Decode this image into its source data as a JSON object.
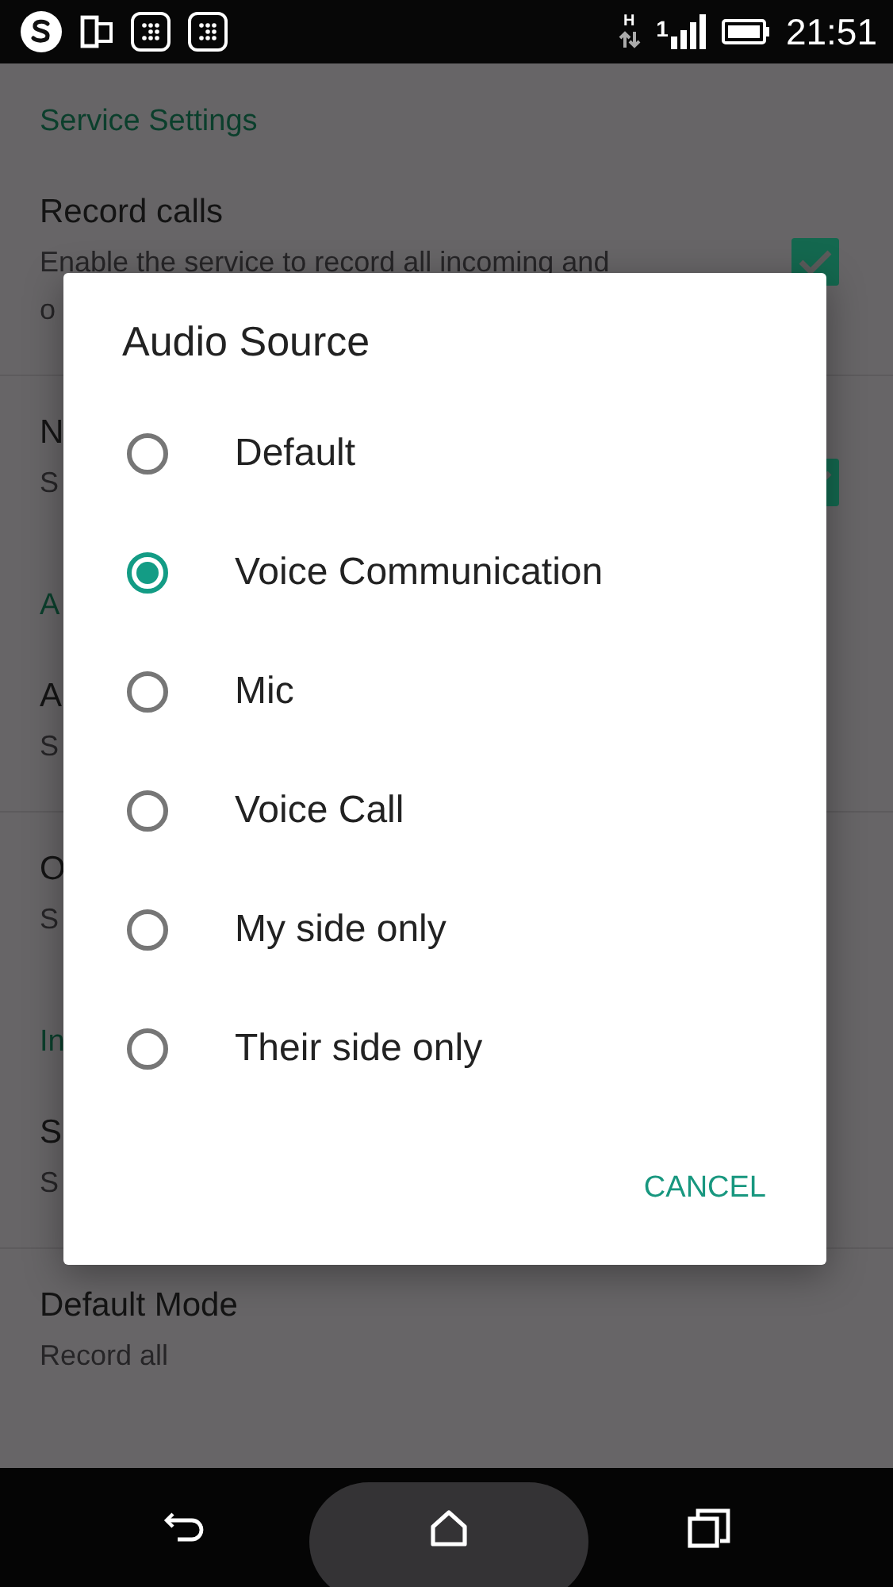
{
  "status_bar": {
    "network_type": "H",
    "sim": "1",
    "time": "21:51"
  },
  "settings": [
    {
      "header": "Service Settings",
      "items": [
        {
          "title": "Record calls",
          "summary": [
            "Enable the service to record all incoming and",
            "o"
          ],
          "kind": "checkbox",
          "checked": true
        },
        {
          "title": "N",
          "summary": [
            "S"
          ],
          "kind": "checkbox",
          "checked": true
        }
      ]
    },
    {
      "header": "A",
      "items": [
        {
          "title": "A",
          "summary": [
            "S"
          ],
          "kind": "plain"
        },
        {
          "title": "O",
          "summary": [
            "S"
          ],
          "kind": "plain"
        }
      ]
    },
    {
      "header": "In",
      "items": [
        {
          "title": "S",
          "summary": [
            "S"
          ],
          "kind": "plain"
        },
        {
          "title": "Default Mode",
          "summary": [
            "Record all"
          ],
          "kind": "plain"
        }
      ]
    }
  ],
  "dialog": {
    "title": "Audio Source",
    "options": [
      {
        "label": "Default",
        "selected": false
      },
      {
        "label": "Voice Communication",
        "selected": true
      },
      {
        "label": "Mic",
        "selected": false
      },
      {
        "label": "Voice Call",
        "selected": false
      },
      {
        "label": "My side only",
        "selected": false
      },
      {
        "label": "Their side only",
        "selected": false
      }
    ],
    "buttons": [
      "CANCEL"
    ]
  }
}
